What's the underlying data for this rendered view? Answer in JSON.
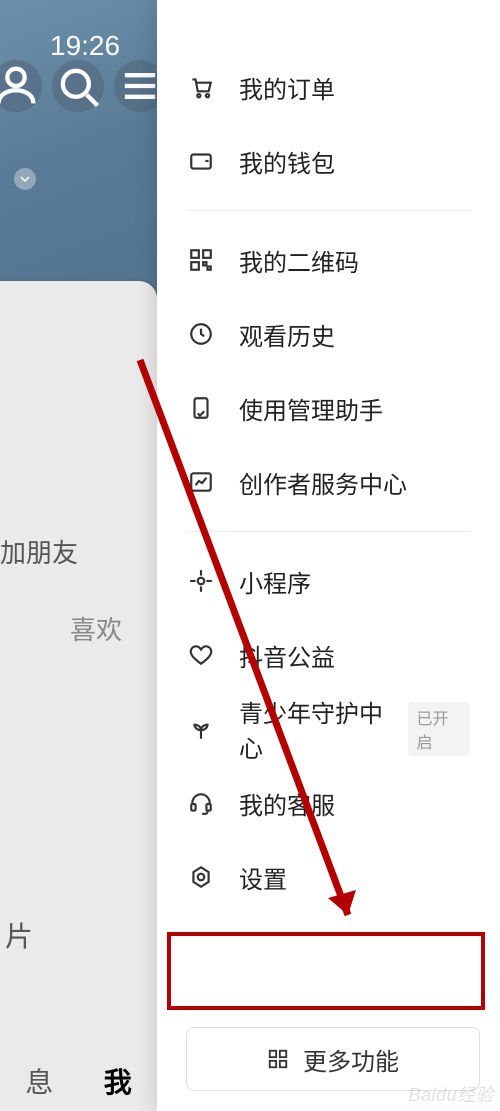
{
  "status": {
    "time": "19:26"
  },
  "background": {
    "add_friend": "加朋友",
    "like_tab": "喜欢",
    "pian": "片",
    "nav_msg": "息",
    "nav_me": "我"
  },
  "menu": {
    "orders": "我的订单",
    "wallet": "我的钱包",
    "qrcode": "我的二维码",
    "history": "观看历史",
    "usage_assistant": "使用管理助手",
    "creator_center": "创作者服务中心",
    "miniapp": "小程序",
    "charity": "抖音公益",
    "teen_guard": "青少年守护中心",
    "teen_guard_badge": "已开启",
    "support": "我的客服",
    "settings": "设置"
  },
  "more_button": "更多功能",
  "watermark": "Baidu经验"
}
